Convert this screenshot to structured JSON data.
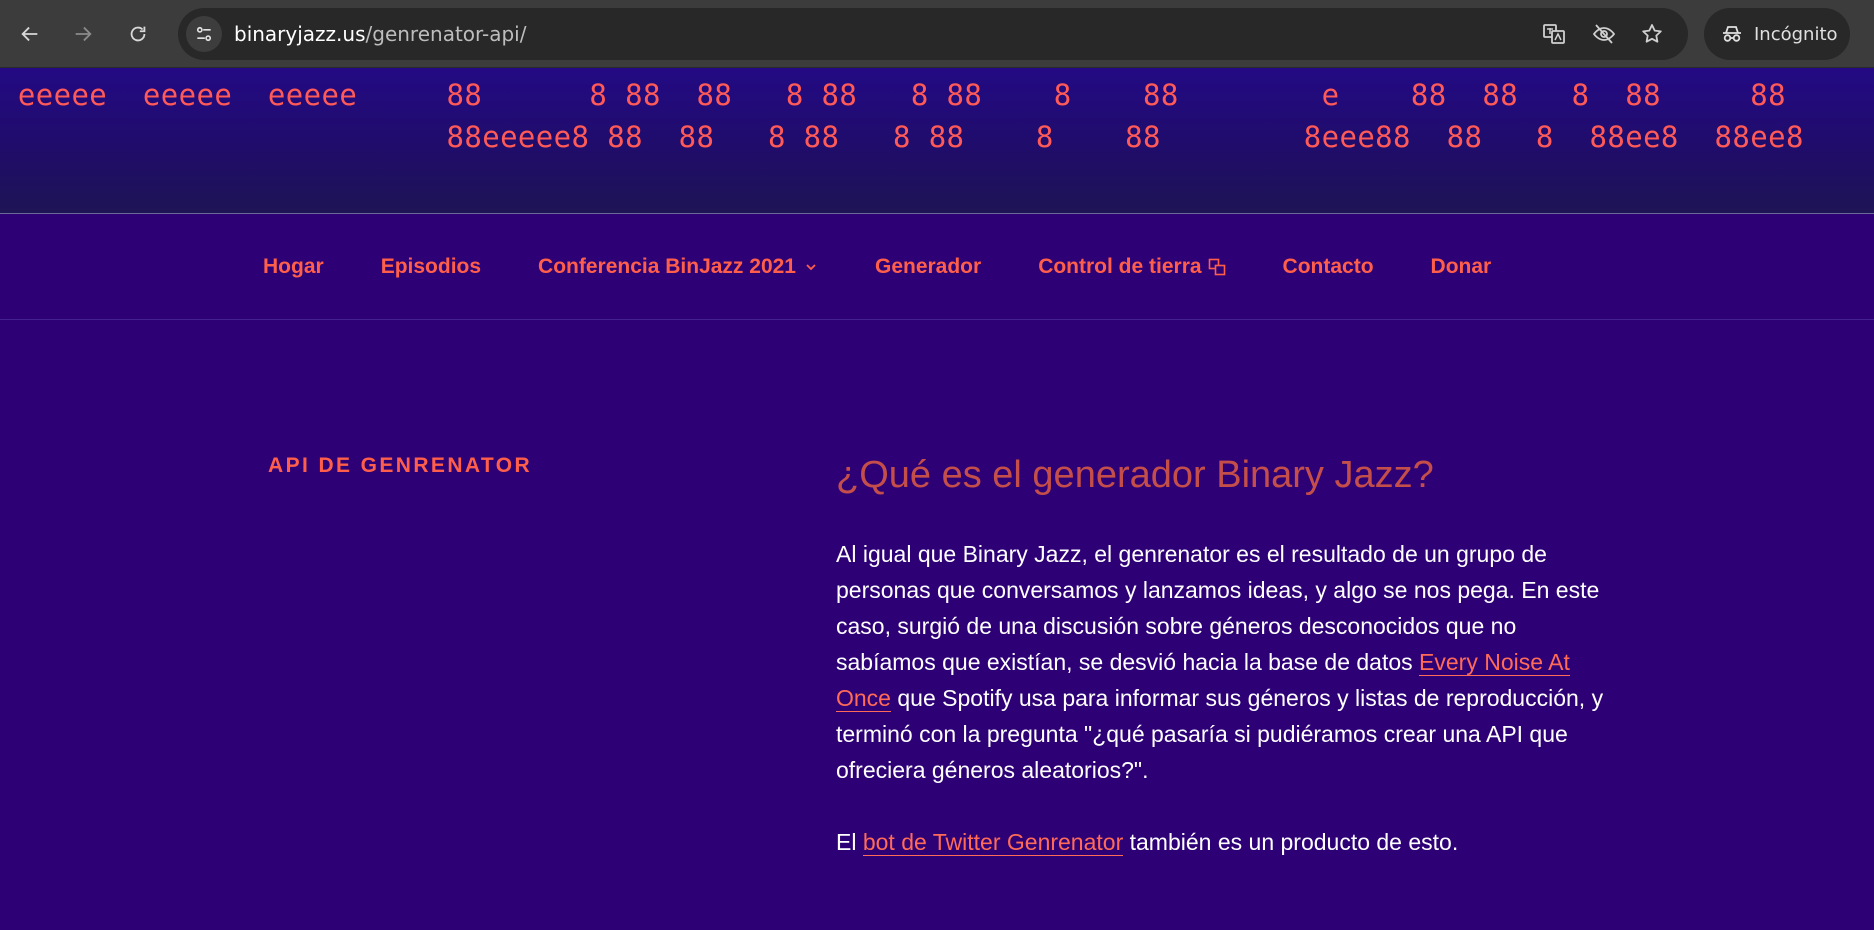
{
  "browser": {
    "url_host": "binaryjazz.us",
    "url_path": "/genrenator-api/",
    "incognito_label": "Incógnito"
  },
  "header": {
    "ascii_lines": [
      " eeeee  eeeee  eeeee     88      8 88  88   8 88   8 88    8    88        e    88  88   8  88     88          eeeee  eeeee  eeeee",
      "                         88eeeee8 88  88   8 88   8 88    8    88        8eee88  88   8  88ee8  88ee8"
    ]
  },
  "nav": {
    "items": [
      {
        "label": "Hogar"
      },
      {
        "label": "Episodios"
      },
      {
        "label": "Conferencia BinJazz 2021"
      },
      {
        "label": "Generador"
      },
      {
        "label": "Control de tierra"
      },
      {
        "label": "Contacto"
      },
      {
        "label": "Donar"
      }
    ]
  },
  "page": {
    "title": "API de genrenator",
    "heading": "¿Qué es el generador Binary Jazz?",
    "p1_text1": "Al igual que Binary Jazz, el genrenator es el resultado de un grupo de personas que conversamos y lanzamos ideas, y algo se nos pega. En este caso, surgió de una discusión sobre géneros desconocidos que no sabíamos que existían, se desvió hacia la base de datos ",
    "p1_link": "Every Noise At Once",
    "p1_text2": " que Spotify usa para informar sus géneros y listas de reproducción, y terminó con la pregunta \"¿qué pasaría si pudiéramos crear una API que ofreciera géneros aleatorios?\".",
    "p2_text1": "El ",
    "p2_link": "bot de Twitter Genrenator",
    "p2_text2": " también es un producto de esto."
  },
  "colors": {
    "background": "#2e0076",
    "accent": "#ff5f4a",
    "heading": "#c44e4a",
    "chrome": "#3c3c3c"
  }
}
